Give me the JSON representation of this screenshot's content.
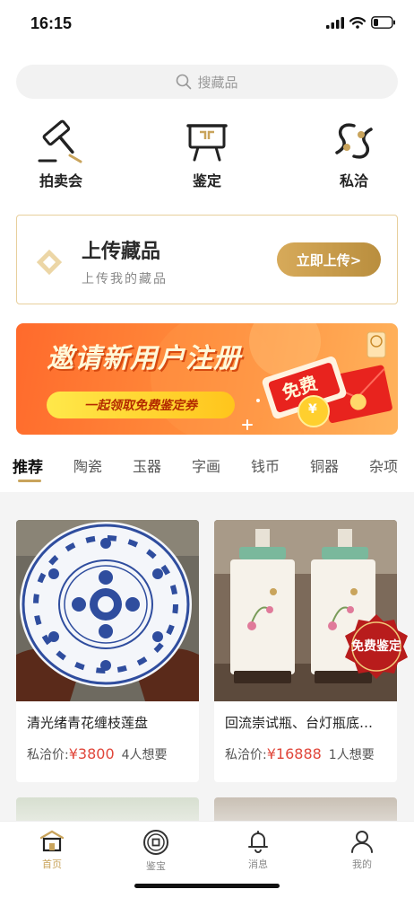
{
  "status": {
    "time": "16:15"
  },
  "search": {
    "placeholder": "搜藏品"
  },
  "categories": [
    {
      "label": "拍卖会",
      "icon": "auction-gavel-icon"
    },
    {
      "label": "鉴定",
      "icon": "appraisal-easel-icon"
    },
    {
      "label": "私洽",
      "icon": "private-deal-icon"
    }
  ],
  "upload": {
    "title": "上传藏品",
    "subtitle": "上传我的藏品",
    "button": "立即上传>"
  },
  "banner": {
    "headline": "邀请新用户注册",
    "pill": "一起领取免费鉴定券",
    "badge_text": "免费",
    "coin": "¥"
  },
  "tabs": [
    "推荐",
    "陶瓷",
    "玉器",
    "字画",
    "钱币",
    "铜器",
    "杂项"
  ],
  "products": [
    {
      "name": "清光绪青花缠枝莲盘",
      "price_label": "私洽价:",
      "price": "¥3800",
      "want": "4人想要"
    },
    {
      "name": "回流崇试瓶、台灯瓶底…",
      "price_label": "私洽价:",
      "price": "¥16888",
      "want": "1人想要"
    }
  ],
  "badge": {
    "text": "免费鉴定"
  },
  "nav": [
    {
      "label": "首页",
      "active": true
    },
    {
      "label": "鉴宝",
      "active": false
    },
    {
      "label": "消息",
      "active": false
    },
    {
      "label": "我的",
      "active": false
    }
  ],
  "colors": {
    "gold": "#c9a45c",
    "price_red": "#e0463a",
    "banner_orange": "#ff6a2c"
  }
}
